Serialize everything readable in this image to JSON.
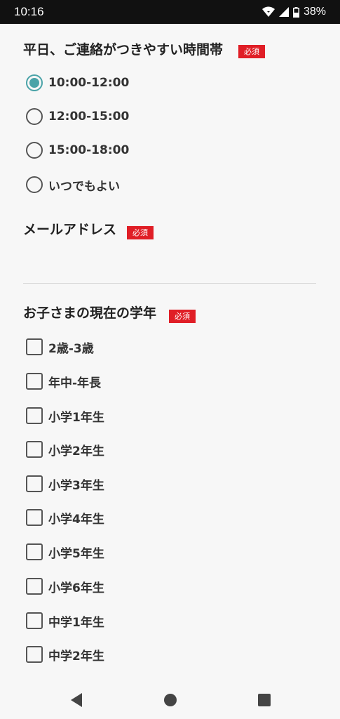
{
  "status_bar": {
    "time": "10:16",
    "battery": "38%"
  },
  "contact_time": {
    "title": "平日、ご連絡がつきやすい時間帯",
    "required": "必須",
    "options": [
      "10:00-12:00",
      "12:00-15:00",
      "15:00-18:00",
      "いつでもよい"
    ],
    "selected_index": 0
  },
  "email": {
    "title": "メールアドレス",
    "required": "必須",
    "value": ""
  },
  "grade": {
    "title": "お子さまの現在の学年",
    "required": "必須",
    "options": [
      "2歳-3歳",
      "年中-年長",
      "小学1年生",
      "小学2年生",
      "小学3年生",
      "小学4年生",
      "小学5年生",
      "小学6年生",
      "中学1年生",
      "中学2年生"
    ]
  },
  "colors": {
    "accent": "#4aa3a8",
    "required_badge": "#e01e26"
  },
  "nav_icons": [
    "back-icon",
    "home-icon",
    "recents-icon"
  ]
}
